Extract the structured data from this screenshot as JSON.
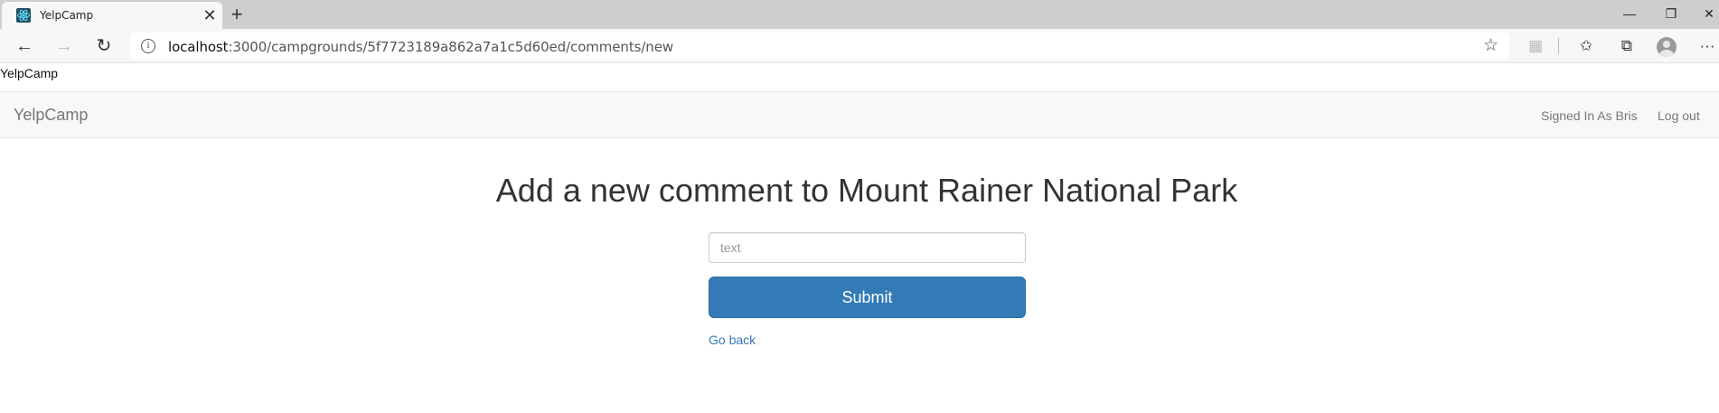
{
  "browser": {
    "tab": {
      "title": "YelpCamp",
      "close": "✕"
    },
    "new_tab": "+",
    "window_controls": {
      "minimize": "—",
      "restore": "❐",
      "close": "✕"
    },
    "nav": {
      "back": "←",
      "forward": "→",
      "reload": "↻"
    },
    "address": {
      "host": "localhost",
      "path": ":3000/campgrounds/5f7723189a862a7a1c5d60ed/comments/new"
    },
    "toolbar_icons": {
      "favorite": "☆",
      "extension": "▦",
      "favorites": "✩",
      "collections": "⧉",
      "menu": "···"
    }
  },
  "page": {
    "top_text": "YelpCamp",
    "navbar": {
      "brand": "YelpCamp",
      "signed_in": "Signed In As Bris",
      "logout": "Log out"
    },
    "heading": "Add a new comment to Mount Rainer National Park",
    "form": {
      "text_placeholder": "text",
      "text_value": "",
      "submit_label": "Submit"
    },
    "go_back": "Go back"
  }
}
